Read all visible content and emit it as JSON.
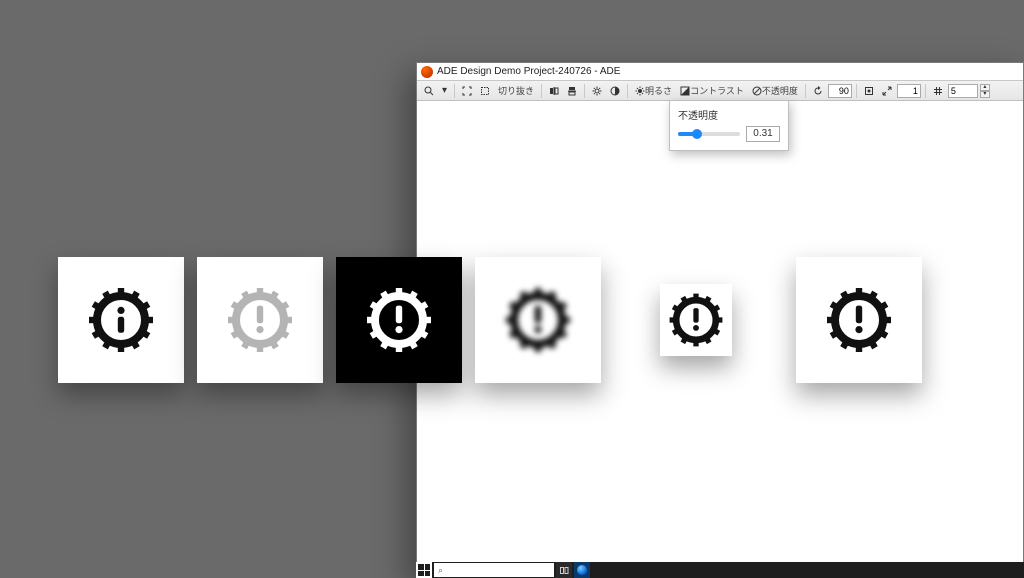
{
  "window": {
    "title": "ADE Design Demo Project-240726 - ADE"
  },
  "toolbar": {
    "crop_label": "切り抜き",
    "brightness_label": "明るさ",
    "contrast_label": "コントラスト",
    "opacity_label": "不透明度",
    "rotation_value": "90",
    "scale_value": "1",
    "grid_value": "5"
  },
  "popover": {
    "title": "不透明度",
    "value_text": "0.31",
    "value_pct": 31
  },
  "taskbar": {
    "search_placeholder": "",
    "search_icon": "⌕"
  },
  "icon_glyphs": {
    "tile1": "i",
    "tile2": "!",
    "tile3": "!",
    "tile4": "!",
    "tile5": "!",
    "tile6": "!"
  }
}
